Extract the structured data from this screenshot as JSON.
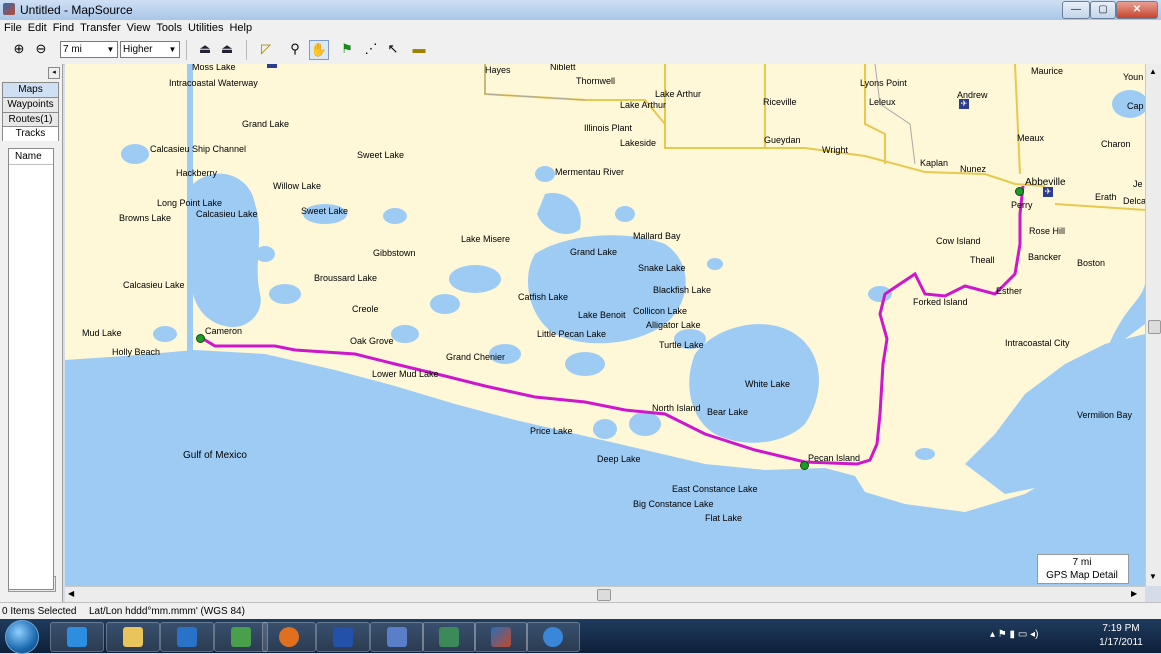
{
  "window": {
    "title": "Untitled - MapSource",
    "min": "—",
    "max": "▢",
    "close": "✕"
  },
  "menu": [
    "File",
    "Edit",
    "Find",
    "Transfer",
    "View",
    "Tools",
    "Utilities",
    "Help"
  ],
  "toolbar": {
    "zoom_value": "7 mi",
    "detail_value": "Higher"
  },
  "left_tabs": {
    "maps": "Maps",
    "waypoints": "Waypoints",
    "routes": "Routes(1)",
    "tracks": "Tracks"
  },
  "list": {
    "column_name": "Name"
  },
  "map": {
    "labels": {
      "moss_lake": "Moss Lake",
      "hayes": "Hayes",
      "niblett": "Niblett",
      "thornwell": "Thornwell",
      "lake_arthur": "Lake Arthur",
      "lake_arthur_town": "Lake Arthur",
      "riceville": "Riceville",
      "lyons_point": "Lyons Point",
      "leleux": "Leleux",
      "andrew": "Andrew",
      "maurice": "Maurice",
      "youngsville": "Youn",
      "cap": "Cap",
      "intracoastal_waterway": "Intracoastal Waterway",
      "grand_lake_n": "Grand Lake",
      "illinois_plant": "Illinois Plant",
      "lakeside": "Lakeside",
      "gueydan": "Gueydan",
      "wright": "Wright",
      "meaux": "Meaux",
      "charon": "Charon",
      "calcasieu_ship_channel": "Calcasieu Ship Channel",
      "sweet_lake": "Sweet Lake",
      "kaplan": "Kaplan",
      "nunez": "Nunez",
      "hackberry": "Hackberry",
      "mermentau_river": "Mermentau River",
      "abbeville": "Abbeville",
      "jen": "Je",
      "willow_lake": "Willow Lake",
      "perry": "Perry",
      "erath": "Erath",
      "delcambre": "Delca",
      "long_point_lake": "Long Point Lake",
      "calcasieu_lake_n": "Calcasieu Lake",
      "sweet_lake_water": "Sweet Lake",
      "browns_lake": "Browns Lake",
      "lake_misere": "Lake Misere",
      "mallard_bay": "Mallard Bay",
      "cow_island": "Cow Island",
      "rose_hill": "Rose Hill",
      "gibbstown": "Gibbstown",
      "grand_lake_s": "Grand Lake",
      "theall": "Theall",
      "bancker": "Bancker",
      "boston": "Boston",
      "snake_lake": "Snake Lake",
      "broussard_lake": "Broussard Lake",
      "calcasieu_lake": "Calcasieu Lake",
      "blackfish_lake": "Blackfish Lake",
      "esther": "Esther",
      "catfish_lake": "Catfish Lake",
      "forked_island": "Forked Island",
      "creole": "Creole",
      "lake_benoit": "Lake Benoit",
      "collicon_lake": "Collicon Lake",
      "alligator_lake": "Alligator Lake",
      "mud_lake": "Mud Lake",
      "cameron": "Cameron",
      "little_pecan_lake": "Little Pecan Lake",
      "oak_grove": "Oak Grove",
      "turtle_lake": "Turtle Lake",
      "intracoastal_city": "Intracoastal City",
      "holly_beach": "Holly Beach",
      "grand_chenier": "Grand Chenier",
      "lower_mud_lake": "Lower Mud Lake",
      "white_lake": "White Lake",
      "north_island": "North Island",
      "bear_lake": "Bear Lake",
      "vermilion_bay": "Vermilion Bay",
      "price_lake": "Price Lake",
      "gulf_of_mexico": "Gulf of Mexico",
      "deep_lake": "Deep Lake",
      "pecan_island": "Pecan Island",
      "east_constance_lake": "East Constance Lake",
      "big_constance_lake": "Big Constance Lake",
      "flat_lake": "Flat Lake"
    },
    "scale": {
      "value": "7 mi",
      "detail_label": "GPS Map Detail"
    },
    "colors": {
      "land": "#fef8d9",
      "water": "#9ecbf3",
      "route": "#cc17cc",
      "road": "#e8c84d",
      "border": "#a8a8a8"
    }
  },
  "status": {
    "selected": "0 Items Selected",
    "format": "Lat/Lon hddd°mm.mmm' (WGS 84)"
  },
  "taskbar": {
    "time": "7:19 PM",
    "date": "1/17/2011"
  }
}
